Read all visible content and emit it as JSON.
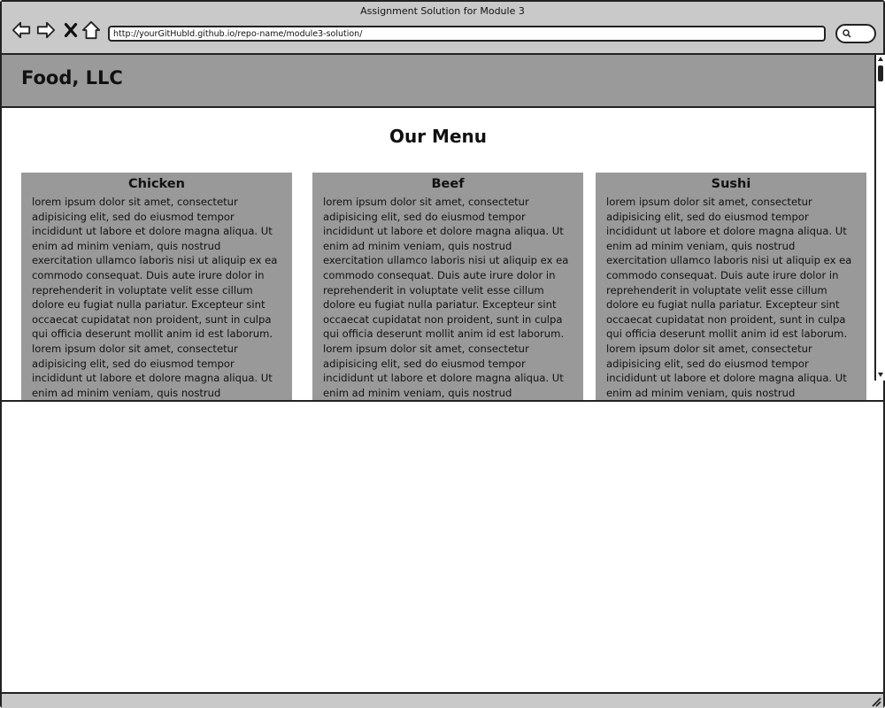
{
  "window": {
    "title": "Assignment Solution for Module 3"
  },
  "toolbar": {
    "back_icon": "back-arrow-icon",
    "forward_icon": "forward-arrow-icon",
    "close_icon": "close-x-icon",
    "home_icon": "home-icon",
    "search_icon": "search-icon"
  },
  "address_bar": {
    "url": "http://yourGitHubId.github.io/repo-name/module3-solution/"
  },
  "site": {
    "brand": "Food, LLC",
    "page_title": "Our Menu"
  },
  "menu": {
    "categories": [
      {
        "name": "Chicken",
        "description": "lorem ipsum dolor sit amet, consectetur adipisicing elit, sed do eiusmod tempor incididunt ut labore et dolore magna aliqua. Ut enim ad minim veniam, quis nostrud exercitation ullamco laboris nisi ut aliquip ex ea commodo consequat. Duis aute irure dolor in reprehenderit in voluptate velit esse cillum dolore eu fugiat nulla pariatur. Excepteur sint occaecat cupidatat non proident, sunt in culpa qui officia deserunt mollit anim id est laborum. lorem ipsum dolor sit amet, consectetur adipisicing elit, sed do eiusmod tempor incididunt ut labore et dolore magna aliqua. Ut enim ad minim veniam, quis nostrud exercitation ullamco laboris nisi ut aliquip ex ea"
      },
      {
        "name": "Beef",
        "description": "lorem ipsum dolor sit amet, consectetur adipisicing elit, sed do eiusmod tempor incididunt ut labore et dolore magna aliqua. Ut enim ad minim veniam, quis nostrud exercitation ullamco laboris nisi ut aliquip ex ea commodo consequat. Duis aute irure dolor in reprehenderit in voluptate velit esse cillum dolore eu fugiat nulla pariatur. Excepteur sint occaecat cupidatat non proident, sunt in culpa qui officia deserunt mollit anim id est laborum. lorem ipsum dolor sit amet, consectetur adipisicing elit, sed do eiusmod tempor incididunt ut labore et dolore magna aliqua. Ut enim ad minim veniam, quis nostrud exercitation ullamco laboris nisi ut aliquip"
      },
      {
        "name": "Sushi",
        "description": "lorem ipsum dolor sit amet, consectetur adipisicing elit, sed do eiusmod tempor incididunt ut labore et dolore magna aliqua. Ut enim ad minim veniam, quis nostrud exercitation ullamco laboris nisi ut aliquip ex ea commodo consequat. Duis aute irure dolor in reprehenderit in voluptate velit esse cillum dolore eu fugiat nulla pariatur. Excepteur sint occaecat cupidatat non proident, sunt in culpa qui officia deserunt mollit anim id est laborum. lorem ipsum dolor sit amet, consectetur adipisicing elit, sed do eiusmod tempor incididunt ut labore et dolore magna aliqua. Ut enim ad minim veniam, quis nostrud exercitation ullamco laboris nisi ut"
      }
    ]
  },
  "colors": {
    "chrome": "#c9c9c9",
    "site_header": "#9a9a9a",
    "card_background": "#999999",
    "outline": "#222222"
  }
}
